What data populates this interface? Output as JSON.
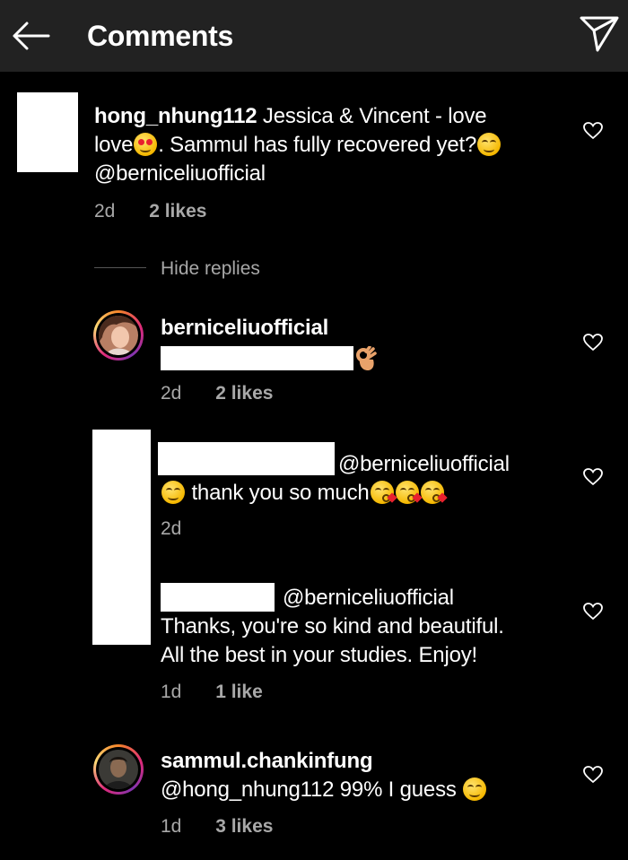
{
  "header": {
    "title": "Comments"
  },
  "comments": [
    {
      "username": "hong_nhung112",
      "text_part1": "Jessica & Vincent - love",
      "text_part2": "love",
      "text_part3": ". Sammul has fully recovered yet?",
      "mention": "@berniceliuofficial",
      "time": "2d",
      "likes": "2 likes"
    }
  ],
  "hide_replies_label": "Hide replies",
  "replies": [
    {
      "username": "berniceliuofficial",
      "time": "2d",
      "likes": "2 likes"
    },
    {
      "mention": "@berniceliuofficial",
      "text": "thank you so much",
      "time": "2d"
    },
    {
      "mention": "@berniceliuofficial",
      "text_line1": "Thanks, you're so kind and beautiful.",
      "text_line2": "All the best in your studies. Enjoy!",
      "time": "1d",
      "likes": "1 like"
    },
    {
      "username": "sammul.chankinfung",
      "mention": "@hong_nhung112",
      "text": "99% I guess",
      "time": "1d",
      "likes": "3 likes"
    }
  ],
  "icons": {
    "back": "arrow-left-icon",
    "send": "paper-plane-icon",
    "like": "heart-outline-icon"
  },
  "colors": {
    "header_bg": "#222222",
    "background": "#000000",
    "text": "#ffffff",
    "meta": "#a8a8a8"
  }
}
